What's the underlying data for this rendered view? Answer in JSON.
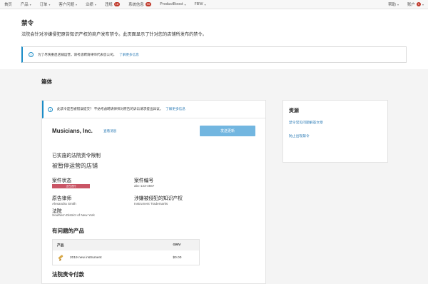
{
  "nav": {
    "items": [
      {
        "label": "首页",
        "caret": false
      },
      {
        "label": "产品",
        "caret": true
      },
      {
        "label": "订单",
        "caret": true
      },
      {
        "label": "客户问题",
        "caret": true
      },
      {
        "label": "业绩",
        "caret": true
      },
      {
        "label": "违规",
        "badge": "18",
        "caret": false
      },
      {
        "label": "系统信息",
        "badge": "55",
        "caret": false
      },
      {
        "label": "ProductBoost",
        "caret": true
      },
      {
        "label": "FBW",
        "caret": true
      }
    ],
    "help": "帮助",
    "account": "账户",
    "account_badge": "1"
  },
  "page": {
    "title": "禁令",
    "description": "法院会针对涉嫌侵犯原告知识产权的商户发布禁令。此页面显示了针对您的店铺所发布的禁令。",
    "alert_text": "为了尽快重启店铺运营，请考虑聘请律师代表您公司。",
    "alert_link": "了解更多信息"
  },
  "section": {
    "title": "箱体"
  },
  "injunction": {
    "alert_text": "此禁令是否被错误提交？ 不妨考虑聘请律师对原告的诉讼请求提出异议。",
    "alert_link": "了解更多信息",
    "store_name": "Musicians, Inc.",
    "view_messages": "查看消息",
    "send_button": "发送更新",
    "restrict_heading": "已实施的法院责令限制",
    "restrict_value": "被暂停运营的店铺",
    "case_status_label": "案件状态",
    "case_status_value": "正在进行",
    "case_number_label": "案件编号",
    "case_number_value": "abc-123-4567",
    "plaintiff_lawyer_label": "原告律师",
    "plaintiff_lawyer_value": "Alexandra Smith",
    "ip_label": "涉嫌被侵犯的知识产权",
    "ip_value": "Instrument Trademarks",
    "court_label": "法院",
    "court_value": "Southern District of New York",
    "products_heading": "有问题的产品",
    "products_table": {
      "headers": [
        "产品",
        "GMV"
      ],
      "rows": [
        {
          "name": "2019 new instrument",
          "gmv": "$0.00"
        }
      ]
    },
    "payments_heading": "法院责令付款"
  },
  "resources": {
    "title": "资源",
    "links": [
      "禁令常见问题解答文章",
      "防止出现禁令"
    ]
  },
  "colors": {
    "accent": "#1a8cc7",
    "button": "#72b6e0",
    "badge_red": "#c0392b",
    "status_badge": "#c95565",
    "link": "#2a7ab5"
  }
}
